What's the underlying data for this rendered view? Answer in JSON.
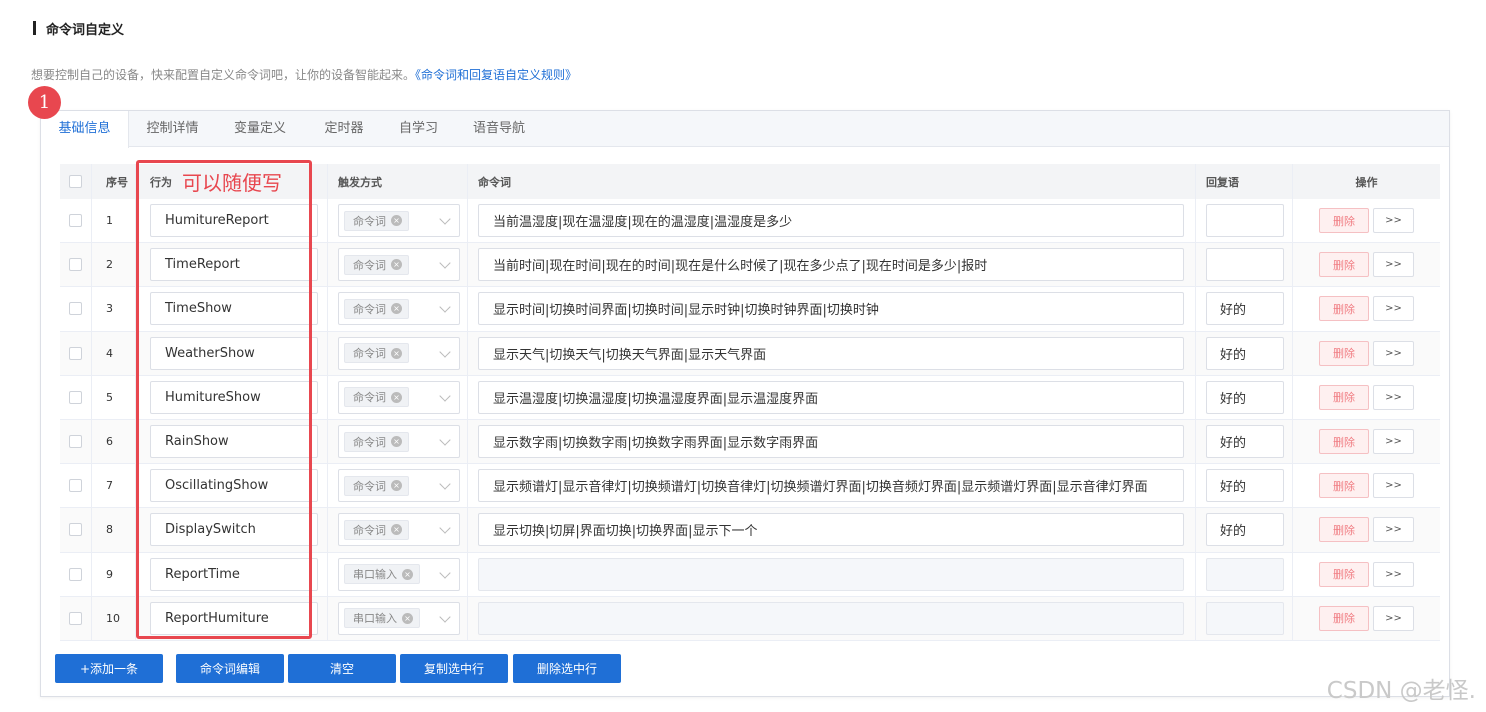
{
  "section": {
    "title": "命令词自定义"
  },
  "description": {
    "text": "想要控制自己的设备，快来配置自定义命令词吧，让你的设备智能起来。",
    "link": "《命令词和回复语自定义规则》"
  },
  "step_badge": "1",
  "tabs": [
    {
      "label": "基础信息",
      "active": true
    },
    {
      "label": "控制详情",
      "active": false
    },
    {
      "label": "变量定义",
      "active": false
    },
    {
      "label": "定时器",
      "active": false
    },
    {
      "label": "自学习",
      "active": false
    },
    {
      "label": "语音导航",
      "active": false
    }
  ],
  "table": {
    "headers": {
      "index": "序号",
      "action": "行为",
      "trigger": "触发方式",
      "command": "命令词",
      "reply": "回复语",
      "operation": "操作"
    },
    "delete_label": "删除",
    "more_label": ">>",
    "rows": [
      {
        "index": "1",
        "action": "HumitureReport",
        "trigger": "命令词",
        "command": "当前温湿度|现在温湿度|现在的温湿度|温湿度是多少",
        "reply": ""
      },
      {
        "index": "2",
        "action": "TimeReport",
        "trigger": "命令词",
        "command": "当前时间|现在时间|现在的时间|现在是什么时候了|现在多少点了|现在时间是多少|报时",
        "reply": ""
      },
      {
        "index": "3",
        "action": "TimeShow",
        "trigger": "命令词",
        "command": "显示时间|切换时间界面|切换时间|显示时钟|切换时钟界面|切换时钟",
        "reply": "好的"
      },
      {
        "index": "4",
        "action": "WeatherShow",
        "trigger": "命令词",
        "command": "显示天气|切换天气|切换天气界面|显示天气界面",
        "reply": "好的"
      },
      {
        "index": "5",
        "action": "HumitureShow",
        "trigger": "命令词",
        "command": "显示温湿度|切换温湿度|切换温湿度界面|显示温湿度界面",
        "reply": "好的"
      },
      {
        "index": "6",
        "action": "RainShow",
        "trigger": "命令词",
        "command": "显示数字雨|切换数字雨|切换数字雨界面|显示数字雨界面",
        "reply": "好的"
      },
      {
        "index": "7",
        "action": "OscillatingShow",
        "trigger": "命令词",
        "command": "显示频谱灯|显示音律灯|切换频谱灯|切换音律灯|切换频谱灯界面|切换音频灯界面|显示频谱灯界面|显示音律灯界面",
        "reply": "好的"
      },
      {
        "index": "8",
        "action": "DisplaySwitch",
        "trigger": "命令词",
        "command": "显示切换|切屏|界面切换|切换界面|显示下一个",
        "reply": "好的"
      },
      {
        "index": "9",
        "action": "ReportTime",
        "trigger": "串口输入",
        "command": "",
        "reply": "",
        "disabled": true
      },
      {
        "index": "10",
        "action": "ReportHumiture",
        "trigger": "串口输入",
        "command": "",
        "reply": "",
        "disabled": true
      }
    ]
  },
  "annotation": {
    "note": "可以随便写",
    "color": "#e8474f"
  },
  "footer_buttons": [
    {
      "label": "+添加一条"
    },
    {
      "label": "命令词编辑"
    },
    {
      "label": "清空"
    },
    {
      "label": "复制选中行"
    },
    {
      "label": "删除选中行"
    }
  ],
  "watermark": "CSDN @老怪.",
  "colors": {
    "accent": "#1f6fd6",
    "danger": "#e8474f"
  }
}
